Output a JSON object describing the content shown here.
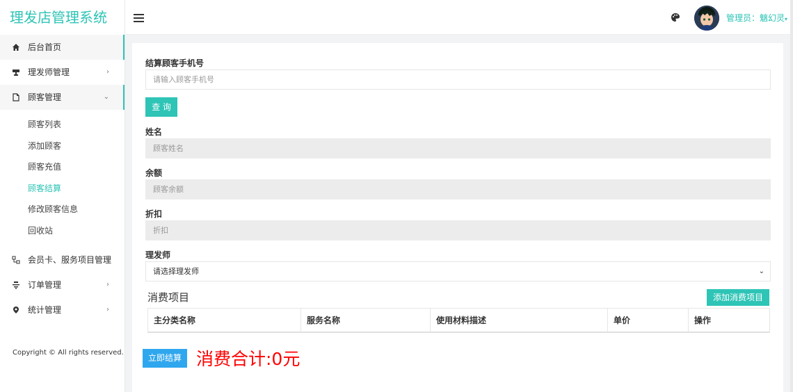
{
  "app": {
    "title": "理发店管理系统"
  },
  "sidebar": {
    "items": [
      {
        "label": "后台首页",
        "icon": "home-icon",
        "arrow": ""
      },
      {
        "label": "理发师管理",
        "icon": "person-icon",
        "arrow": "›"
      },
      {
        "label": "顾客管理",
        "icon": "document-icon",
        "arrow": "⌄"
      }
    ],
    "subitems": [
      "顾客列表",
      "添加顾客",
      "顾客充值",
      "顾客结算",
      "修改顾客信息",
      "回收站"
    ],
    "items_after": [
      {
        "label": "会员卡、服务项目管理",
        "icon": "grid-icon",
        "arrow": "›"
      },
      {
        "label": "订单管理",
        "icon": "list-icon",
        "arrow": "›"
      },
      {
        "label": "统计管理",
        "icon": "location-icon",
        "arrow": "›"
      }
    ],
    "copyright": "Copyright © All rights reserved."
  },
  "topbar": {
    "admin_label": "管理员：魑幻灵",
    "caret": "▾"
  },
  "form": {
    "phone_label": "结算顾客手机号",
    "phone_placeholder": "请输入顾客手机号",
    "query_button": "查 询",
    "name_label": "姓名",
    "name_placeholder": "顾客姓名",
    "balance_label": "余额",
    "balance_placeholder": "顾客余额",
    "discount_label": "折扣",
    "discount_placeholder": "折扣",
    "barber_label": "理发师",
    "barber_selected": "请选择理发师"
  },
  "consumption": {
    "title": "消费项目",
    "add_button": "添加消费项目",
    "columns": [
      "主分类名称",
      "服务名称",
      "使用材料描述",
      "单价",
      "操作"
    ]
  },
  "checkout": {
    "button": "立即结算",
    "total": "消费合计:0元"
  },
  "colors": {
    "accent": "#2ec4b6",
    "blue": "#2fa7ee",
    "total": "#ff0000"
  }
}
